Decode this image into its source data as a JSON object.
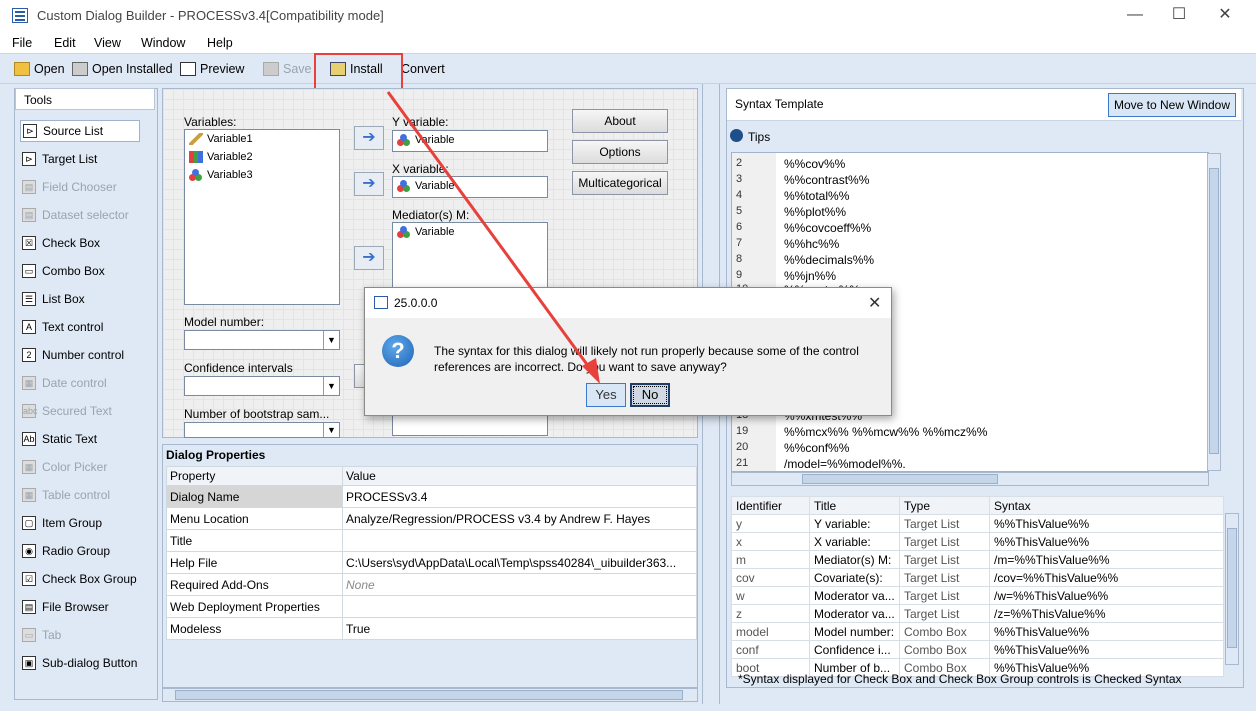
{
  "window": {
    "title": "Custom Dialog Builder - PROCESSv3.4[Compatibility mode]",
    "minimize": "—",
    "maximize": "☐",
    "close": "✕"
  },
  "menu": [
    "File",
    "Edit",
    "View",
    "Window",
    "Help"
  ],
  "toolbar": {
    "open": "Open",
    "open_installed": "Open Installed",
    "preview": "Preview",
    "save": "Save",
    "install": "Install",
    "convert": "Convert"
  },
  "tools": {
    "header": "Tools",
    "items": [
      {
        "label": "Source List",
        "enabled": true
      },
      {
        "label": "Target List",
        "enabled": true
      },
      {
        "label": "Field Chooser",
        "enabled": false
      },
      {
        "label": "Dataset selector",
        "enabled": false
      },
      {
        "label": "Check Box",
        "enabled": true
      },
      {
        "label": "Combo Box",
        "enabled": true
      },
      {
        "label": "List Box",
        "enabled": true
      },
      {
        "label": "Text control",
        "enabled": true
      },
      {
        "label": "Number control",
        "enabled": true
      },
      {
        "label": "Date control",
        "enabled": false
      },
      {
        "label": "Secured Text",
        "enabled": false
      },
      {
        "label": "Static Text",
        "enabled": true
      },
      {
        "label": "Color Picker",
        "enabled": false
      },
      {
        "label": "Table control",
        "enabled": false
      },
      {
        "label": "Item Group",
        "enabled": true
      },
      {
        "label": "Radio Group",
        "enabled": true
      },
      {
        "label": "Check Box Group",
        "enabled": true
      },
      {
        "label": "File Browser",
        "enabled": true
      },
      {
        "label": "Tab",
        "enabled": false
      },
      {
        "label": "Sub-dialog Button",
        "enabled": true
      }
    ]
  },
  "canvas": {
    "variables_label": "Variables:",
    "variables": [
      "Variable1",
      "Variable2",
      "Variable3"
    ],
    "y_label": "Y variable:",
    "x_label": "X variable:",
    "m_label": "Mediator(s) M:",
    "target_item": "Variable",
    "model_label": "Model number:",
    "ci_label": "Confidence intervals",
    "boot_label": "Number of bootstrap sam...",
    "about": "About",
    "options": "Options",
    "multicat": "Multicategorical"
  },
  "properties": {
    "title": "Dialog Properties",
    "col_property": "Property",
    "col_value": "Value",
    "rows": [
      {
        "p": "Dialog Name",
        "v": "PROCESSv3.4"
      },
      {
        "p": "Menu Location",
        "v": "Analyze/Regression/PROCESS v3.4 by Andrew F. Hayes"
      },
      {
        "p": "Title",
        "v": ""
      },
      {
        "p": "Help File",
        "v": "C:\\Users\\syd\\AppData\\Local\\Temp\\spss40284\\_uibuilder363..."
      },
      {
        "p": "Required Add-Ons",
        "v": "None"
      },
      {
        "p": "Web Deployment Properties",
        "v": ""
      },
      {
        "p": "Modeless",
        "v": "True"
      }
    ]
  },
  "syntax": {
    "header": "Syntax Template",
    "move_button": "Move to New Window",
    "tips": "Tips",
    "lines": [
      {
        "n": "2",
        "t": "%%cov%%"
      },
      {
        "n": "3",
        "t": "%%contrast%%"
      },
      {
        "n": "4",
        "t": "%%total%%"
      },
      {
        "n": "5",
        "t": "%%plot%%"
      },
      {
        "n": "6",
        "t": "%%covcoeff%%"
      },
      {
        "n": "7",
        "t": "%%hc%%"
      },
      {
        "n": "8",
        "t": "%%decimals%%"
      },
      {
        "n": "9",
        "t": "%%jn%%"
      },
      {
        "n": "10",
        "t": "%%center%%"
      },
      {
        "n": "18",
        "t": "%%xmtest%%"
      },
      {
        "n": "19",
        "t": "%%mcx%% %%mcw%% %%mcz%%"
      },
      {
        "n": "20",
        "t": "%%conf%%"
      },
      {
        "n": "21",
        "t": "/model=%%model%%."
      }
    ]
  },
  "identifiers": {
    "cols": [
      "Identifier",
      "Title",
      "Type",
      "Syntax"
    ],
    "rows": [
      [
        "y",
        "Y variable:",
        "Target List",
        "%%ThisValue%%"
      ],
      [
        "x",
        "X variable:",
        "Target List",
        "%%ThisValue%%"
      ],
      [
        "m",
        "Mediator(s) M:",
        "Target List",
        "/m=%%ThisValue%%"
      ],
      [
        "cov",
        "Covariate(s):",
        "Target List",
        "/cov=%%ThisValue%%"
      ],
      [
        "w",
        "Moderator va...",
        "Target List",
        "/w=%%ThisValue%%"
      ],
      [
        "z",
        "Moderator va...",
        "Target List",
        "/z=%%ThisValue%%"
      ],
      [
        "model",
        "Model number:",
        "Combo Box",
        "%%ThisValue%%"
      ],
      [
        "conf",
        "Confidence i...",
        "Combo Box",
        "%%ThisValue%%"
      ],
      [
        "boot",
        "Number of b...",
        "Combo Box",
        "%%ThisValue%%"
      ]
    ]
  },
  "footer_note": "*Syntax displayed for Check Box and Check Box Group controls is Checked Syntax",
  "dialog": {
    "title": "25.0.0.0",
    "message_line1": "The syntax for this dialog will likely not run properly because some of the control",
    "message_line2": "references are incorrect.  Do you want to save anyway?",
    "yes": "Yes",
    "no": "No"
  }
}
